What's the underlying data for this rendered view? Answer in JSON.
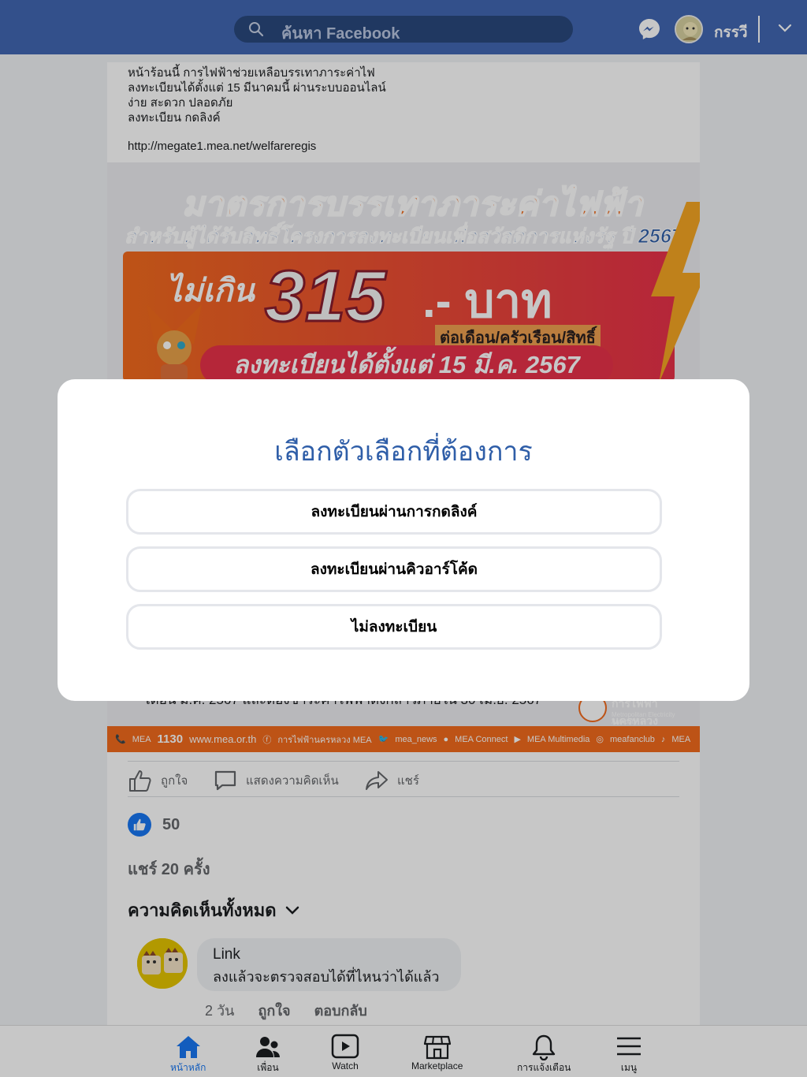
{
  "topbar": {
    "search_placeholder": "ค้นหา Facebook",
    "user_name": "กรรวี",
    "brand_color": "#4267b2"
  },
  "post": {
    "text_lines": [
      "หน้าร้อนนี้ การไฟฟ้าช่วยเหลือบรรเทาภาระค่าไฟ",
      "ลงทะเบียนได้ตั้งแต่ 15 มีนาคมนี้ ผ่านระบบออนไลน์",
      "ง่าย สะดวก ปลอดภัย",
      "ลงทะเบียน กดลิงค์"
    ],
    "link": "http://megate1.mea.net/welfareregis",
    "banner": {
      "title": "มาตรการบรรเทาภาระค่าไฟฟ้า",
      "subtitle": "สำหรับผู้ได้รับสิทธิ์โครงการลงทะเบียนเพื่อสวัสดิการแห่งรัฐ ปี 2567",
      "not_over": "ไม่เกิน",
      "amount": "315",
      "baht": ".- บาท",
      "per": "ต่อเดือน/ครัวเรือน/สิทธิ์",
      "register_from": "ลงทะเบียนได้ตั้งแต่ 15 มี.ค. 2567",
      "condition": "เดือน มี.ค. 2567 และต้องชำระค่าไฟฟ้าดังกล่าวภายใน 30 เม.ย. 2567",
      "logo_name": "การไฟฟ้านครหลวง",
      "logo_sub": "Metropolitan Electricity Authority",
      "footer": {
        "callcenter": "MEA",
        "callnum": "1130",
        "website": "www.mea.or.th",
        "facebook": "การไฟฟ้านครหลวง MEA",
        "twitter": "mea_news",
        "line": "MEA Connect",
        "youtube": "MEA Multimedia",
        "instagram": "meafanclub",
        "tiktok": "MEA"
      }
    },
    "actions": {
      "like": "ถูกใจ",
      "comment": "แสดงความคิดเห็น",
      "share": "แชร์"
    },
    "like_count": "50",
    "shares": "แชร์ 20 ครั้ง",
    "all_comments": "ความคิดเห็นทั้งหมด",
    "comment": {
      "name": "Link",
      "text": "ลงแล้วจะตรวจสอบได้ที่ไหนว่าได้แล้ว",
      "time": "2 วัน",
      "like": "ถูกใจ",
      "reply": "ตอบกลับ"
    }
  },
  "bottomnav": {
    "items": [
      "หน้าหลัก",
      "เพื่อน",
      "Watch",
      "Marketplace",
      "การแจ้งเตือน",
      "เมนู"
    ],
    "active_color": "#1877f2"
  },
  "modal": {
    "title": "เลือกตัวเลือกที่ต้องการ",
    "options": [
      "ลงทะเบียนผ่านการกดลิงค์",
      "ลงทะเบียนผ่านคิวอาร์โค้ด",
      "ไม่ลงทะเบียน"
    ],
    "title_color": "#2f5ea8"
  }
}
